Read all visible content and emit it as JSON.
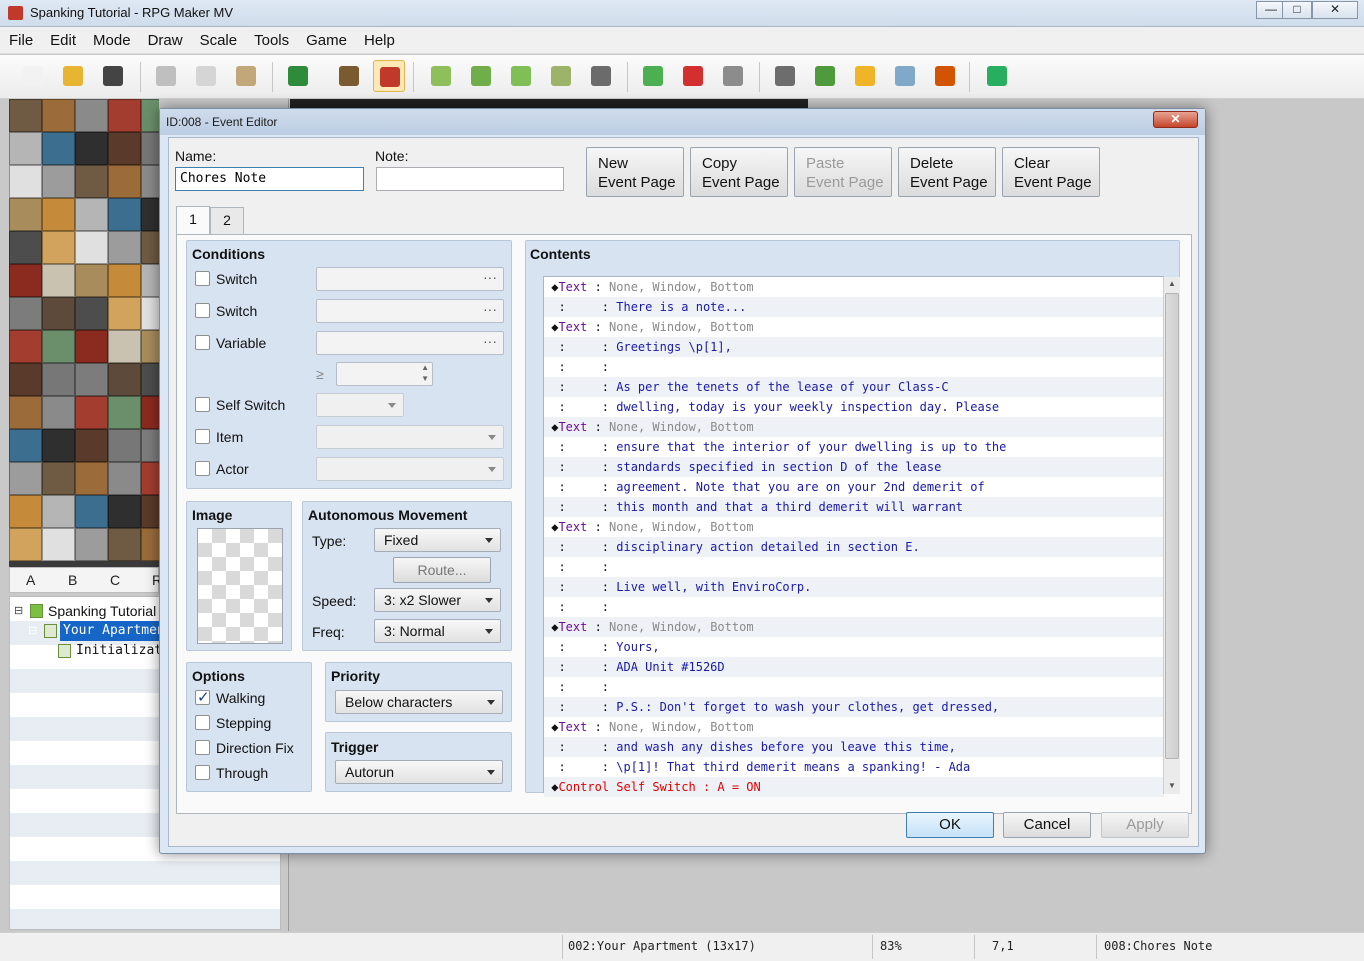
{
  "window": {
    "title": "Spanking Tutorial - RPG Maker MV",
    "controls": {
      "minimize": "—",
      "maximize": "□",
      "close": "✕"
    }
  },
  "menu": [
    "File",
    "Edit",
    "Mode",
    "Draw",
    "Scale",
    "Tools",
    "Game",
    "Help"
  ],
  "toolbar": [
    {
      "name": "new-project",
      "color": "#f2f2f2"
    },
    {
      "name": "open-project",
      "color": "#e7b532"
    },
    {
      "name": "save-project",
      "color": "#444444"
    },
    {
      "name": "cut",
      "color": "#bfbfbf"
    },
    {
      "name": "copy",
      "color": "#d5d5d5"
    },
    {
      "name": "paste",
      "color": "#c2a77b"
    },
    {
      "name": "undo",
      "color": "#2e8b3a"
    },
    {
      "name": "map-mode",
      "color": "#7a5a2e"
    },
    {
      "name": "event-mode",
      "color": "#c0392b"
    },
    {
      "name": "pencil",
      "color": "#8fbf5a"
    },
    {
      "name": "rectangle",
      "color": "#6fae4a"
    },
    {
      "name": "ellipse",
      "color": "#7fbf55"
    },
    {
      "name": "flood-fill",
      "color": "#9db36a"
    },
    {
      "name": "shadow-pen",
      "color": "#6b6b6b"
    },
    {
      "name": "zoom-in",
      "color": "#4caf50"
    },
    {
      "name": "zoom-out",
      "color": "#d32f2f"
    },
    {
      "name": "actual-size",
      "color": "#8c8c8c"
    },
    {
      "name": "database",
      "color": "#6d6d6d"
    },
    {
      "name": "plugin-manager",
      "color": "#4f9a3c"
    },
    {
      "name": "sound-test",
      "color": "#f0b429"
    },
    {
      "name": "event-searcher",
      "color": "#7fa8c9"
    },
    {
      "name": "character-generator",
      "color": "#d35400"
    },
    {
      "name": "playtest",
      "color": "#27ae60"
    }
  ],
  "tileTabs": [
    "A",
    "B",
    "C",
    "R"
  ],
  "mapTree": [
    {
      "label": "Spanking Tutorial",
      "level": 0,
      "expand": "⊟",
      "selected": false
    },
    {
      "label": "Your Apartment",
      "level": 1,
      "expand": "⊟",
      "selected": true
    },
    {
      "label": "Initialization",
      "level": 2,
      "expand": "",
      "selected": false
    }
  ],
  "status": {
    "map": "002:Your Apartment (13x17)",
    "zoom": "83%",
    "coords": "7,1",
    "event": "008:Chores Note"
  },
  "editor": {
    "title": "ID:008 - Event Editor",
    "close": "✕",
    "name_label": "Name:",
    "name_value": "Chores Note",
    "note_label": "Note:",
    "note_value": "",
    "page_buttons": [
      {
        "line1": "New",
        "line2": "Event Page",
        "enabled": true
      },
      {
        "line1": "Copy",
        "line2": "Event Page",
        "enabled": true
      },
      {
        "line1": "Paste",
        "line2": "Event Page",
        "enabled": false
      },
      {
        "line1": "Delete",
        "line2": "Event Page",
        "enabled": true
      },
      {
        "line1": "Clear",
        "line2": "Event Page",
        "enabled": true
      }
    ],
    "page_tabs": [
      "1",
      "2"
    ],
    "active_tab": "1",
    "conditions": {
      "title": "Conditions",
      "switch1": "Switch",
      "switch2": "Switch",
      "variable": "Variable",
      "gte": "≥",
      "self_switch": "Self Switch",
      "item": "Item",
      "actor": "Actor",
      "dots": "···"
    },
    "image": {
      "title": "Image"
    },
    "movement": {
      "title": "Autonomous Movement",
      "type_label": "Type:",
      "type_value": "Fixed",
      "route": "Route...",
      "speed_label": "Speed:",
      "speed_value": "3: x2 Slower",
      "freq_label": "Freq:",
      "freq_value": "3: Normal"
    },
    "options": {
      "title": "Options",
      "items": [
        {
          "label": "Walking",
          "checked": true
        },
        {
          "label": "Stepping",
          "checked": false
        },
        {
          "label": "Direction Fix",
          "checked": false
        },
        {
          "label": "Through",
          "checked": false
        }
      ]
    },
    "priority": {
      "title": "Priority",
      "value": "Below characters"
    },
    "trigger": {
      "title": "Trigger",
      "value": "Autorun"
    },
    "contents": {
      "title": "Contents",
      "lines": [
        {
          "kind": "cmd",
          "cmd": "Text",
          "arg": "None, Window, Bottom"
        },
        {
          "kind": "txt",
          "text": "There is a note..."
        },
        {
          "kind": "cmd",
          "cmd": "Text",
          "arg": "None, Window, Bottom"
        },
        {
          "kind": "txt",
          "text": "Greetings \\p[1],"
        },
        {
          "kind": "txt",
          "text": ""
        },
        {
          "kind": "txt",
          "text": "As per the tenets of the lease of your Class-C"
        },
        {
          "kind": "txt",
          "text": "dwelling, today is your weekly inspection day. Please"
        },
        {
          "kind": "cmd",
          "cmd": "Text",
          "arg": "None, Window, Bottom"
        },
        {
          "kind": "txt",
          "text": "ensure that the interior of your dwelling is up to the"
        },
        {
          "kind": "txt",
          "text": "standards specified in section D of the lease"
        },
        {
          "kind": "txt",
          "text": "agreement. Note that you are on your 2nd demerit of"
        },
        {
          "kind": "txt",
          "text": "this month and that a third demerit will warrant"
        },
        {
          "kind": "cmd",
          "cmd": "Text",
          "arg": "None, Window, Bottom"
        },
        {
          "kind": "txt",
          "text": "disciplinary action detailed in section E."
        },
        {
          "kind": "txt",
          "text": ""
        },
        {
          "kind": "txt",
          "text": "Live well, with EnviroCorp."
        },
        {
          "kind": "txt",
          "text": ""
        },
        {
          "kind": "cmd",
          "cmd": "Text",
          "arg": "None, Window, Bottom"
        },
        {
          "kind": "txt",
          "text": "Yours,"
        },
        {
          "kind": "txt",
          "text": "ADA Unit #1526D"
        },
        {
          "kind": "txt",
          "text": ""
        },
        {
          "kind": "txt",
          "text": "P.S.: Don't forget to wash your clothes, get dressed,"
        },
        {
          "kind": "cmd",
          "cmd": "Text",
          "arg": "None, Window, Bottom"
        },
        {
          "kind": "txt",
          "text": "and wash any dishes before you leave this time,"
        },
        {
          "kind": "txt",
          "text": "\\p[1]! That third demerit means a spanking! - Ada"
        },
        {
          "kind": "red",
          "text": "Control Self Switch : A = ON"
        }
      ]
    },
    "ok": "OK",
    "cancel": "Cancel",
    "apply": "Apply"
  },
  "colors": {
    "accent": "#3c7fb1",
    "selection": "#1666c7",
    "red_command": "#e00000",
    "purple_command": "#6a0d9d",
    "text_blue": "#1a1aa6"
  }
}
